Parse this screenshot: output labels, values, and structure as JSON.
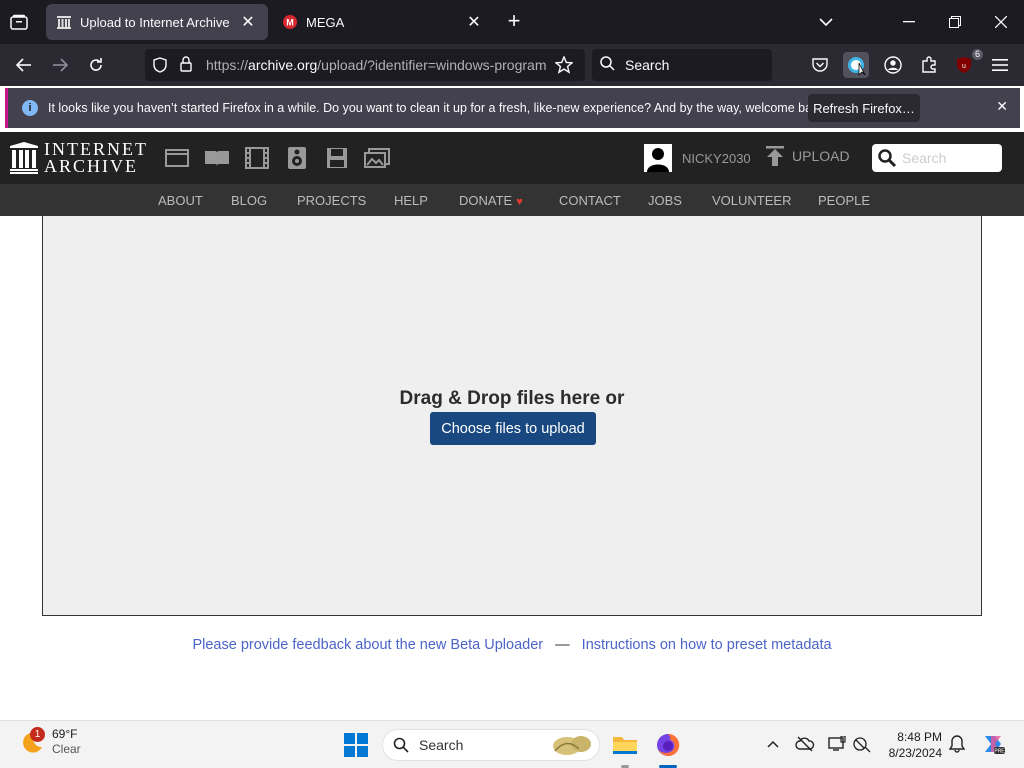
{
  "browser": {
    "tabs": [
      {
        "title": "Upload to Internet Archive",
        "active": true,
        "icon": "archive-icon"
      },
      {
        "title": "MEGA",
        "active": false,
        "icon": "mega-icon"
      }
    ],
    "url_prefix": "https://",
    "url_domain": "archive.org",
    "url_rest": "/upload/?identifier=windows-program",
    "search_placeholder": "Search",
    "extension_badge": "6"
  },
  "notification": {
    "message": "It looks like you haven’t started Firefox in a while. Do you want to clean it up for a fresh, like-new experience? And by the way, welcome back!",
    "button": "Refresh Firefox…"
  },
  "archive": {
    "logo_line1": "INTERNET",
    "logo_line2": "ARCHIVE",
    "username": "NICKY2030",
    "upload_label": "UPLOAD",
    "search_placeholder": "Search",
    "nav": [
      "ABOUT",
      "BLOG",
      "PROJECTS",
      "HELP",
      "DONATE",
      "CONTACT",
      "JOBS",
      "VOLUNTEER",
      "PEOPLE"
    ]
  },
  "uploader": {
    "drop_text": "Drag & Drop files here or",
    "choose_button": "Choose files to upload",
    "feedback_link": "Please provide feedback about the new Beta Uploader",
    "separator": "—",
    "instructions_link": "Instructions on how to preset metadata"
  },
  "taskbar": {
    "weather_temp": "69°F",
    "weather_cond": "Clear",
    "weather_badge": "1",
    "search_label": "Search",
    "time": "8:48 PM",
    "date": "8/23/2024"
  },
  "colors": {
    "accent": "#194880",
    "link": "#4b64c8",
    "header_bg": "#222222",
    "subnav_bg": "#333333"
  }
}
